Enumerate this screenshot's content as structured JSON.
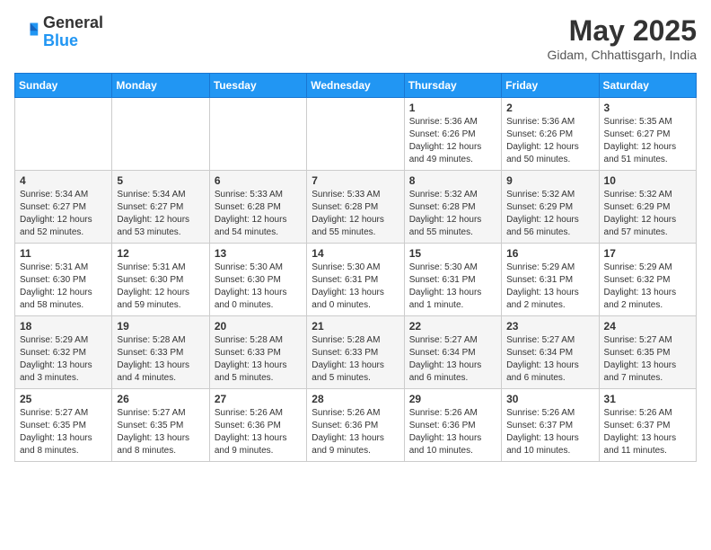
{
  "header": {
    "logo_line1": "General",
    "logo_line2": "Blue",
    "month_title": "May 2025",
    "location": "Gidam, Chhattisgarh, India"
  },
  "days_of_week": [
    "Sunday",
    "Monday",
    "Tuesday",
    "Wednesday",
    "Thursday",
    "Friday",
    "Saturday"
  ],
  "weeks": [
    [
      {
        "day": "",
        "info": ""
      },
      {
        "day": "",
        "info": ""
      },
      {
        "day": "",
        "info": ""
      },
      {
        "day": "",
        "info": ""
      },
      {
        "day": "1",
        "info": "Sunrise: 5:36 AM\nSunset: 6:26 PM\nDaylight: 12 hours\nand 49 minutes."
      },
      {
        "day": "2",
        "info": "Sunrise: 5:36 AM\nSunset: 6:26 PM\nDaylight: 12 hours\nand 50 minutes."
      },
      {
        "day": "3",
        "info": "Sunrise: 5:35 AM\nSunset: 6:27 PM\nDaylight: 12 hours\nand 51 minutes."
      }
    ],
    [
      {
        "day": "4",
        "info": "Sunrise: 5:34 AM\nSunset: 6:27 PM\nDaylight: 12 hours\nand 52 minutes."
      },
      {
        "day": "5",
        "info": "Sunrise: 5:34 AM\nSunset: 6:27 PM\nDaylight: 12 hours\nand 53 minutes."
      },
      {
        "day": "6",
        "info": "Sunrise: 5:33 AM\nSunset: 6:28 PM\nDaylight: 12 hours\nand 54 minutes."
      },
      {
        "day": "7",
        "info": "Sunrise: 5:33 AM\nSunset: 6:28 PM\nDaylight: 12 hours\nand 55 minutes."
      },
      {
        "day": "8",
        "info": "Sunrise: 5:32 AM\nSunset: 6:28 PM\nDaylight: 12 hours\nand 55 minutes."
      },
      {
        "day": "9",
        "info": "Sunrise: 5:32 AM\nSunset: 6:29 PM\nDaylight: 12 hours\nand 56 minutes."
      },
      {
        "day": "10",
        "info": "Sunrise: 5:32 AM\nSunset: 6:29 PM\nDaylight: 12 hours\nand 57 minutes."
      }
    ],
    [
      {
        "day": "11",
        "info": "Sunrise: 5:31 AM\nSunset: 6:30 PM\nDaylight: 12 hours\nand 58 minutes."
      },
      {
        "day": "12",
        "info": "Sunrise: 5:31 AM\nSunset: 6:30 PM\nDaylight: 12 hours\nand 59 minutes."
      },
      {
        "day": "13",
        "info": "Sunrise: 5:30 AM\nSunset: 6:30 PM\nDaylight: 13 hours\nand 0 minutes."
      },
      {
        "day": "14",
        "info": "Sunrise: 5:30 AM\nSunset: 6:31 PM\nDaylight: 13 hours\nand 0 minutes."
      },
      {
        "day": "15",
        "info": "Sunrise: 5:30 AM\nSunset: 6:31 PM\nDaylight: 13 hours\nand 1 minute."
      },
      {
        "day": "16",
        "info": "Sunrise: 5:29 AM\nSunset: 6:31 PM\nDaylight: 13 hours\nand 2 minutes."
      },
      {
        "day": "17",
        "info": "Sunrise: 5:29 AM\nSunset: 6:32 PM\nDaylight: 13 hours\nand 2 minutes."
      }
    ],
    [
      {
        "day": "18",
        "info": "Sunrise: 5:29 AM\nSunset: 6:32 PM\nDaylight: 13 hours\nand 3 minutes."
      },
      {
        "day": "19",
        "info": "Sunrise: 5:28 AM\nSunset: 6:33 PM\nDaylight: 13 hours\nand 4 minutes."
      },
      {
        "day": "20",
        "info": "Sunrise: 5:28 AM\nSunset: 6:33 PM\nDaylight: 13 hours\nand 5 minutes."
      },
      {
        "day": "21",
        "info": "Sunrise: 5:28 AM\nSunset: 6:33 PM\nDaylight: 13 hours\nand 5 minutes."
      },
      {
        "day": "22",
        "info": "Sunrise: 5:27 AM\nSunset: 6:34 PM\nDaylight: 13 hours\nand 6 minutes."
      },
      {
        "day": "23",
        "info": "Sunrise: 5:27 AM\nSunset: 6:34 PM\nDaylight: 13 hours\nand 6 minutes."
      },
      {
        "day": "24",
        "info": "Sunrise: 5:27 AM\nSunset: 6:35 PM\nDaylight: 13 hours\nand 7 minutes."
      }
    ],
    [
      {
        "day": "25",
        "info": "Sunrise: 5:27 AM\nSunset: 6:35 PM\nDaylight: 13 hours\nand 8 minutes."
      },
      {
        "day": "26",
        "info": "Sunrise: 5:27 AM\nSunset: 6:35 PM\nDaylight: 13 hours\nand 8 minutes."
      },
      {
        "day": "27",
        "info": "Sunrise: 5:26 AM\nSunset: 6:36 PM\nDaylight: 13 hours\nand 9 minutes."
      },
      {
        "day": "28",
        "info": "Sunrise: 5:26 AM\nSunset: 6:36 PM\nDaylight: 13 hours\nand 9 minutes."
      },
      {
        "day": "29",
        "info": "Sunrise: 5:26 AM\nSunset: 6:36 PM\nDaylight: 13 hours\nand 10 minutes."
      },
      {
        "day": "30",
        "info": "Sunrise: 5:26 AM\nSunset: 6:37 PM\nDaylight: 13 hours\nand 10 minutes."
      },
      {
        "day": "31",
        "info": "Sunrise: 5:26 AM\nSunset: 6:37 PM\nDaylight: 13 hours\nand 11 minutes."
      }
    ]
  ]
}
